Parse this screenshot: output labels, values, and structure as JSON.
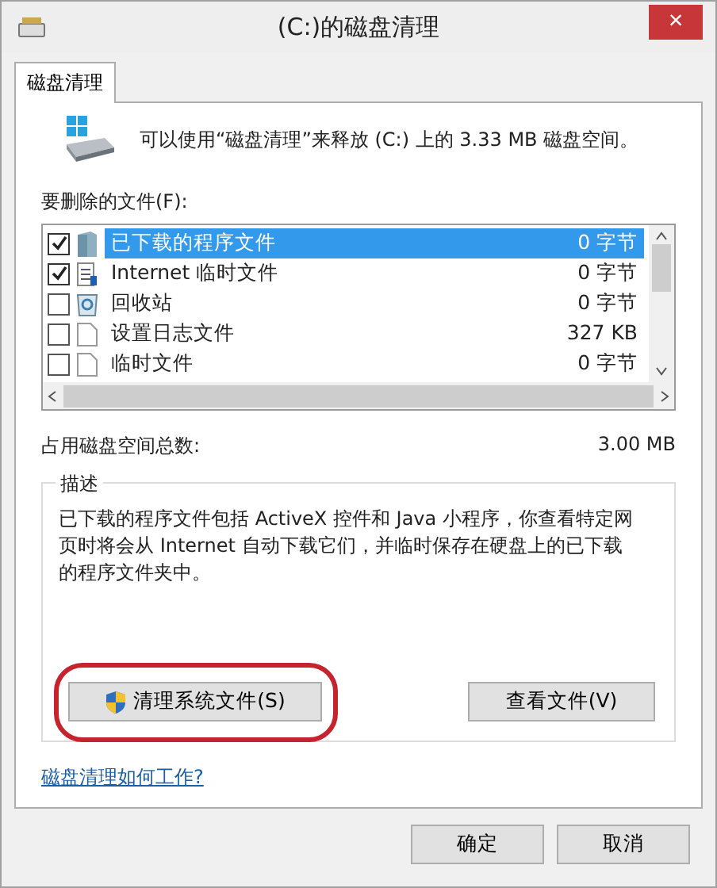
{
  "window": {
    "title": "(C:)的磁盘清理",
    "close": "×"
  },
  "tabs": [
    {
      "label": "磁盘清理",
      "selected": true
    }
  ],
  "intro": "可以使用“磁盘清理”来释放  (C:) 上的 3.33 MB 磁盘空间。",
  "files_label": "要删除的文件(F):",
  "files": [
    {
      "kind": "folder",
      "name": "已下载的程序文件",
      "size": "0 字节",
      "checked": true,
      "selected": true
    },
    {
      "kind": "document",
      "name": "Internet 临时文件",
      "size": "0 字节",
      "checked": true,
      "selected": false
    },
    {
      "kind": "recycle",
      "name": "回收站",
      "size": "0 字节",
      "checked": false,
      "selected": false
    },
    {
      "kind": "blank",
      "name": "设置日志文件",
      "size": "327 KB",
      "checked": false,
      "selected": false
    },
    {
      "kind": "blank",
      "name": "临时文件",
      "size": "0 字节",
      "checked": false,
      "selected": false
    }
  ],
  "total_label": "占用磁盘空间总数:",
  "total_value": "3.00 MB",
  "description": {
    "title": "描述",
    "text": "已下载的程序文件包括 ActiveX 控件和 Java 小程序，你查看特定网页时将会从 Internet 自动下载它们，并临时保存在硬盘上的已下载的程序文件夹中。"
  },
  "clean_system_button": "清理系统文件(S)",
  "view_files_button": "查看文件(V)",
  "help_link": "磁盘清理如何工作?",
  "buttons": [
    "确定",
    "取消"
  ]
}
